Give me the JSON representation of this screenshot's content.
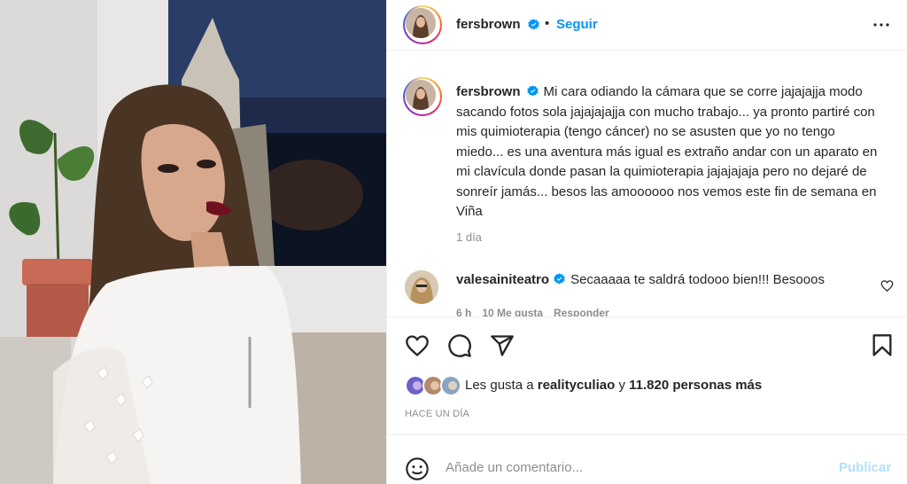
{
  "post": {
    "image_description_alt": "",
    "author": {
      "username": "fersbrown",
      "verified": true
    },
    "follow_label": "Seguir",
    "separator": "•",
    "more_icon": "more-horizontal-icon"
  },
  "caption": {
    "username": "fersbrown",
    "text": "Mi cara odiando la cámara que se corre jajajajja modo sacando fotos sola jajajajajja con mucho trabajo... ya pronto partiré con mis quimioterapia (tengo cáncer) no se asusten que yo no tengo miedo... es una aventura más igual es extraño andar con un aparato en mi clavícula donde pasan la quimioterapia jajajajaja pero no dejaré de sonreír jamás... besos las amoooooo nos vemos este fin de semana en Viña",
    "time": "1 día"
  },
  "comment": {
    "username": "valesainiteatro",
    "text": "Secaaaaa te saldrá todooo bien!!! Besooos",
    "time": "6 h",
    "likes": "10 Me gusta",
    "reply_label": "Responder"
  },
  "actions": {
    "like_icon": "heart-icon",
    "comment_icon": "comment-icon",
    "share_icon": "send-icon",
    "save_icon": "bookmark-icon"
  },
  "likes": {
    "prefix": "Les gusta a",
    "user": "realityculiao",
    "connector": "y",
    "count": "11.820 personas más"
  },
  "post_time": "HACE UN DÍA",
  "add_comment": {
    "placeholder": "Añade un comentario...",
    "publish_label": "Publicar"
  },
  "colors": {
    "accent": "#0095f6",
    "text": "#262626",
    "secondary": "#8e8e8e",
    "publish_disabled": "#b2dffc"
  }
}
